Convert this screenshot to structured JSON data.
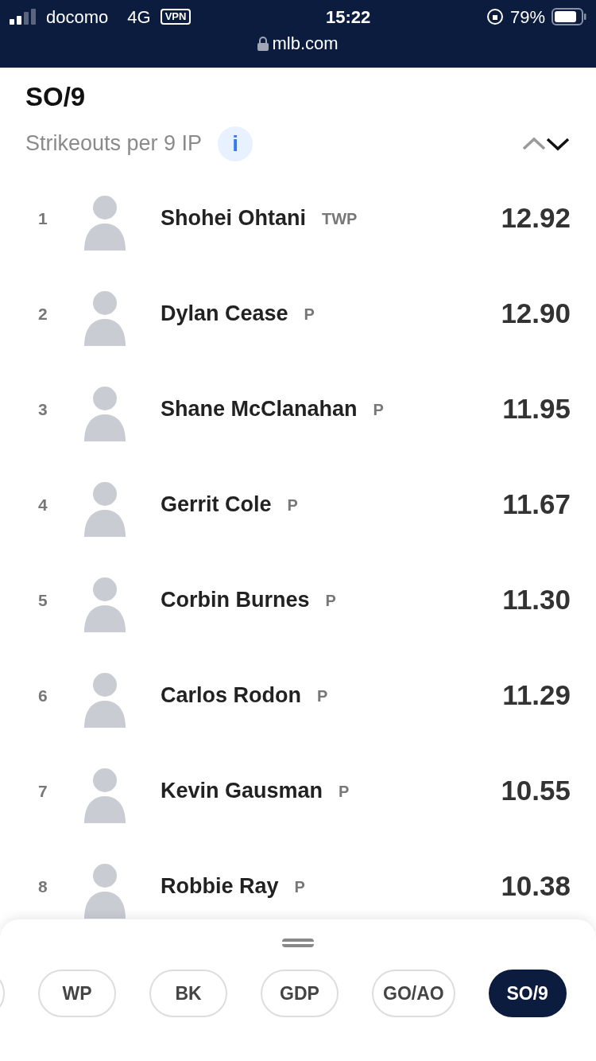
{
  "status_bar": {
    "carrier": "docomo",
    "network": "4G",
    "vpn": "VPN",
    "time": "15:22",
    "battery": "79%",
    "url": "mlb.com"
  },
  "header": {
    "title": "SO/9",
    "subtitle": "Strikeouts per 9 IP",
    "info": "i",
    "sort_descending": true
  },
  "leaders": [
    {
      "rank": "1",
      "name": "Shohei Ohtani",
      "position": "TWP",
      "value": "12.92"
    },
    {
      "rank": "2",
      "name": "Dylan Cease",
      "position": "P",
      "value": "12.90"
    },
    {
      "rank": "3",
      "name": "Shane McClanahan",
      "position": "P",
      "value": "11.95"
    },
    {
      "rank": "4",
      "name": "Gerrit Cole",
      "position": "P",
      "value": "11.67"
    },
    {
      "rank": "5",
      "name": "Corbin Burnes",
      "position": "P",
      "value": "11.30"
    },
    {
      "rank": "6",
      "name": "Carlos Rodon",
      "position": "P",
      "value": "11.29"
    },
    {
      "rank": "7",
      "name": "Kevin Gausman",
      "position": "P",
      "value": "10.55"
    },
    {
      "rank": "8",
      "name": "Robbie Ray",
      "position": "P",
      "value": "10.38"
    }
  ],
  "stat_tabs": [
    {
      "label": "WP",
      "selected": false
    },
    {
      "label": "BK",
      "selected": false
    },
    {
      "label": "GDP",
      "selected": false
    },
    {
      "label": "GO/AO",
      "selected": false
    },
    {
      "label": "SO/9",
      "selected": true
    }
  ]
}
